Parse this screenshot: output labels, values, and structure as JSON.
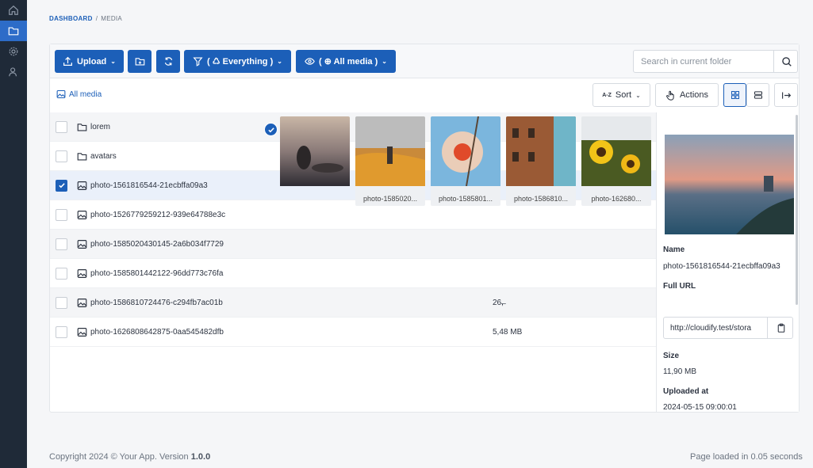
{
  "breadcrumb": {
    "root": "DASHBOARD",
    "separator": "/",
    "current": "MEDIA"
  },
  "toolbar": {
    "upload_label": "Upload",
    "filter_label": "( ♺ Everything )",
    "visibility_label": "( ⊕ All media )",
    "search_placeholder": "Search in current folder"
  },
  "subbar": {
    "all_media_label": "All media",
    "sort_label": "Sort",
    "sort_icon_text": "A-Z",
    "actions_label": "Actions"
  },
  "rows": [
    {
      "type": "folder",
      "name": "lorem",
      "size": "",
      "checked": false
    },
    {
      "type": "folder",
      "name": "avatars",
      "size": "",
      "checked": false
    },
    {
      "type": "image",
      "name": "photo-1561816544-21ecbffa09a3",
      "size": "",
      "checked": true
    },
    {
      "type": "image",
      "name": "photo-1526779259212-939e64788e3c",
      "size": "",
      "checked": false
    },
    {
      "type": "image",
      "name": "photo-1585020430145-2a6b034f7729",
      "size": "",
      "checked": false
    },
    {
      "type": "image",
      "name": "photo-1585801442122-96dd773c76fa",
      "size": "",
      "checked": false
    },
    {
      "type": "image",
      "name": "photo-1586810724476-c294fb7ac01b",
      "size": "26,̶",
      "checked": false
    },
    {
      "type": "image",
      "name": "photo-1626808642875-0aa545482dfb",
      "size": "5,48 MB",
      "checked": false
    }
  ],
  "thumbs": [
    {
      "caption": "",
      "selected": true
    },
    {
      "caption": "photo-1585020...",
      "selected": false
    },
    {
      "caption": "photo-1585801...",
      "selected": false
    },
    {
      "caption": "photo-1586810...",
      "selected": false
    },
    {
      "caption": "photo-162680...",
      "selected": false
    }
  ],
  "details": {
    "name_label": "Name",
    "name_value": "photo-1561816544-21ecbffa09a3",
    "url_label": "Full URL",
    "url_value": "http://cloudify.test/stora",
    "size_label": "Size",
    "size_value": "11,90 MB",
    "uploaded_label": "Uploaded at",
    "uploaded_value": "2024-05-15 09:00:01"
  },
  "footer": {
    "copyright": "Copyright 2024 © Your App. Version ",
    "version": "1.0.0",
    "load_time": "Page loaded in 0.05 seconds"
  },
  "colors": {
    "accent": "#1c5fb8",
    "sidebar": "#1f2a38"
  }
}
